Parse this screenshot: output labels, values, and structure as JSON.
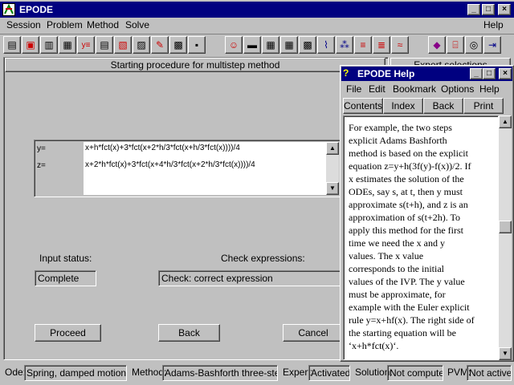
{
  "app": {
    "title": "EPODE",
    "menu": [
      "Session",
      "Problem",
      "Method",
      "Solve",
      "Help"
    ]
  },
  "main": {
    "header": "Starting procedure for multistep method",
    "right_header": "Expert selections",
    "eq": [
      {
        "label": "y=",
        "value": "x+h*fct(x)+3*fct(x+2*h/3*fct(x+h/3*fct(x))))/4"
      },
      {
        "label": "z=",
        "value": "x+2*h*fct(x)+3*fct(x+4*h/3*fct(x+2*h/3*fct(x))))/4"
      }
    ],
    "input_status_label": "Input status:",
    "input_status_value": "Complete",
    "check_label": "Check expressions:",
    "check_value": "Check: correct expression",
    "buttons": {
      "proceed": "Proceed",
      "back": "Back",
      "cancel": "Cancel"
    }
  },
  "help": {
    "title": "EPODE Help",
    "menu": [
      "File",
      "Edit",
      "Bookmark",
      "Options",
      "Help"
    ],
    "nav": [
      "Contents",
      "Index",
      "Back",
      "Print"
    ],
    "lines": [
      "For example, the two steps",
      "explicit Adams Bashforth",
      "method is based on the explicit",
      "equation z=y+h(3f(y)-f(x))/2. If",
      "x estimates the solution of the",
      "ODEs, say s, at t, then y must",
      "approximate s(t+h), and z is an",
      "approximation of s(t+2h). To",
      "apply this method for the first",
      "time we need the x and y",
      "values. The x value",
      "corresponds to the initial",
      "values of the IVP. The y value",
      "must be approximate, for",
      "example with the Euler explicit",
      "rule y=x+hf(x). The right side of",
      "the starting equation will be",
      "‘x+h*fct(x)‘."
    ]
  },
  "status": {
    "ode_label": "Ode:",
    "ode_value": "Spring, damped motion",
    "method_label": "Method:",
    "method_value": "Adams-Bashforth three-step m",
    "expert_label": "Expert:",
    "expert_value": "Activated",
    "solution_label": "Solution:",
    "solution_value": "Not computed",
    "pvm_label": "PVM:",
    "pvm_value": "Not active"
  }
}
